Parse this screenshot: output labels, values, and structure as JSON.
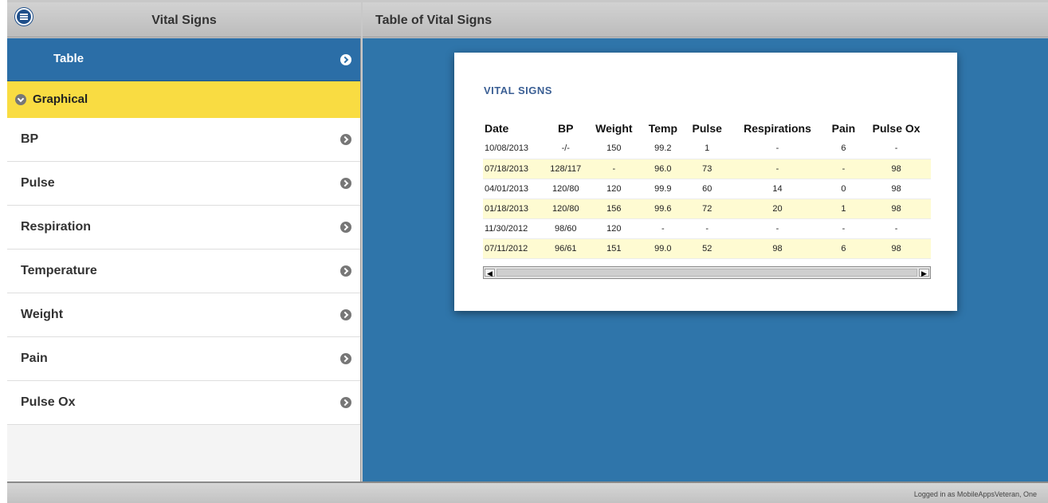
{
  "left_panel": {
    "title": "Vital Signs",
    "menu_button_icon": "menu-icon",
    "nav": {
      "table_label": "Table",
      "graphical_label": "Graphical",
      "items": [
        {
          "label": "BP"
        },
        {
          "label": "Pulse"
        },
        {
          "label": "Respiration"
        },
        {
          "label": "Temperature"
        },
        {
          "label": "Weight"
        },
        {
          "label": "Pain"
        },
        {
          "label": "Pulse Ox"
        }
      ]
    }
  },
  "right_panel": {
    "title": "Table of Vital Signs",
    "card": {
      "title": "VITAL SIGNS",
      "columns": [
        "Date",
        "BP",
        "Weight",
        "Temp",
        "Pulse",
        "Respirations",
        "Pain",
        "Pulse Ox"
      ],
      "rows": [
        [
          "10/08/2013",
          "-/-",
          "150",
          "99.2",
          "1",
          "-",
          "6",
          "-"
        ],
        [
          "07/18/2013",
          "128/117",
          "-",
          "96.0",
          "73",
          "-",
          "-",
          "98"
        ],
        [
          "04/01/2013",
          "120/80",
          "120",
          "99.9",
          "60",
          "14",
          "0",
          "98"
        ],
        [
          "01/18/2013",
          "120/80",
          "156",
          "99.6",
          "72",
          "20",
          "1",
          "98"
        ],
        [
          "11/30/2012",
          "98/60",
          "120",
          "-",
          "-",
          "-",
          "-",
          "-"
        ],
        [
          "07/11/2012",
          "96/61",
          "151",
          "99.0",
          "52",
          "98",
          "6",
          "98"
        ]
      ]
    }
  },
  "footer": {
    "status": "Logged in as MobileAppsVeteran, One"
  },
  "colors": {
    "accent_blue": "#2f75aa",
    "nav_selected": "#2b6ea7",
    "nav_expanded": "#f9dc42",
    "row_highlight": "#fefbd2"
  }
}
